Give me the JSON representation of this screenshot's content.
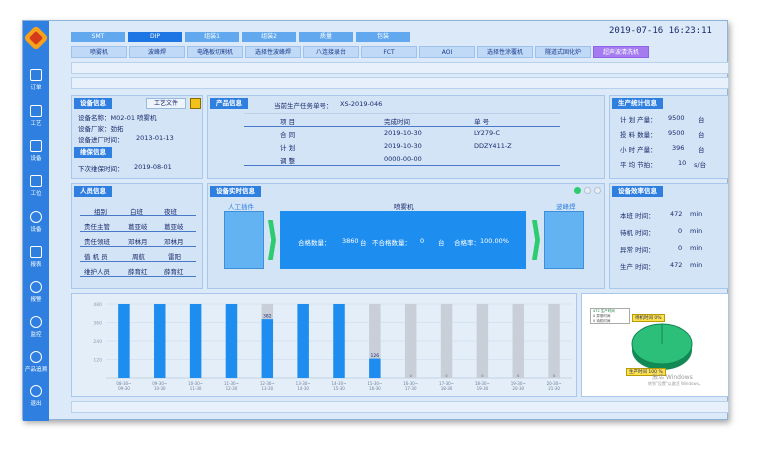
{
  "top_tabs": [
    "SMT",
    "DIP",
    "组装1",
    "组装2",
    "质量",
    "包装"
  ],
  "sub_tabs": [
    "喷雾机",
    "波峰焊",
    "电路板切割机",
    "选择性波峰焊",
    "八连接录台",
    "FCT",
    "AOI",
    "选择性涂覆机",
    "隧道式固化炉",
    "超声波清洗机"
  ],
  "clock": "2019-07-16  16:23:11",
  "sidebar": [
    "订单",
    "工艺",
    "设备",
    "工位",
    "设备",
    "报表",
    "报警",
    "监控",
    "产品追溯",
    "退出"
  ],
  "device_info": {
    "title": "设备信息",
    "file_button": "工艺文件",
    "name": "设备名称：M02-01 喷雾机",
    "maker": "设备厂家：劲拓",
    "date_label": "设备进厂时间：",
    "date": "2013-01-13"
  },
  "maint_info": {
    "title": "维保信息",
    "label": "下次维保时间：",
    "date": "2019-08-01"
  },
  "product_info": {
    "title": "产品信息",
    "order_label": "当前生产任务单号：",
    "order": "XS-2019-046",
    "headers": [
      "项  目",
      "完成时间",
      "单  号"
    ],
    "rows": [
      [
        "合  同",
        "2019-10-30",
        "LY279-C"
      ],
      [
        "计  划",
        "2019-10-30",
        "DDZY411-Z"
      ],
      [
        "调  整",
        "0000-00-00",
        ""
      ]
    ]
  },
  "prod_stats": {
    "title": "生产统计信息",
    "rows": [
      [
        "计  划  产量：",
        "9500",
        "台"
      ],
      [
        "投  料  数量：",
        "9500",
        "台"
      ],
      [
        "小  时  产量：",
        "396",
        "台"
      ],
      [
        "平  均  节拍：",
        "10",
        "s/台"
      ]
    ]
  },
  "personnel": {
    "title": "人员信息",
    "headers": [
      "组别",
      "白班",
      "夜班"
    ],
    "rows": [
      [
        "责任主管",
        "葛亚岐",
        "葛亚岐"
      ],
      [
        "责任领班",
        "邓林月",
        "邓林月"
      ],
      [
        "值  机  员",
        "周航",
        "雷阳"
      ],
      [
        "维护人员",
        "薛育红",
        "薛育红"
      ]
    ]
  },
  "realtime": {
    "title": "设备实时信息",
    "left": "人工插件",
    "center": "喷雾机",
    "right": "波峰焊",
    "ok_label": "合格数量：",
    "ok": "3860",
    "ok_unit": "台",
    "ng_label": "不合格数量：",
    "ng": "0",
    "ng_unit": "台",
    "rate_label": "合格率：",
    "rate": "100.00%"
  },
  "efficiency": {
    "title": "设备效率信息",
    "rows": [
      [
        "本班  时间：",
        "472",
        "min"
      ],
      [
        "待机  时间：",
        "0",
        "min"
      ],
      [
        "异常  时间：",
        "0",
        "min"
      ],
      [
        "生产  时间：",
        "472",
        "min"
      ]
    ]
  },
  "pie": {
    "legend": [
      "472 生产时间",
      "0 异常时间",
      "0 待机时间"
    ],
    "tag_top": "待机时间 0%",
    "tag_bottom": "生产时间 100 %",
    "watermark": "激活 Windows",
    "watermark2": "转到\"设置\"以激活 Windows。"
  },
  "chart_data": {
    "type": "bar",
    "categories": [
      "08-30~09-30",
      "09-30~10-30",
      "10-30~11-30",
      "11-30~12-30",
      "12-30~13-30",
      "13-30~14-30",
      "14-30~15-30",
      "15-30~16-30",
      "16-30~17-30",
      "17-30~18-30",
      "18-30~19-30",
      "19-30~20-30",
      "20-30~21-30"
    ],
    "values": [
      480,
      480,
      480,
      480,
      382,
      480,
      480,
      126,
      0,
      0,
      0,
      0,
      0
    ],
    "ylim": [
      0,
      480
    ],
    "yticks": [
      "480",
      "360",
      "240",
      "120"
    ],
    "data_labels": {
      "4": "382",
      "7": "126"
    },
    "colors": {
      "done": "#1d8ef0",
      "todo": "#c8cfd8"
    }
  }
}
